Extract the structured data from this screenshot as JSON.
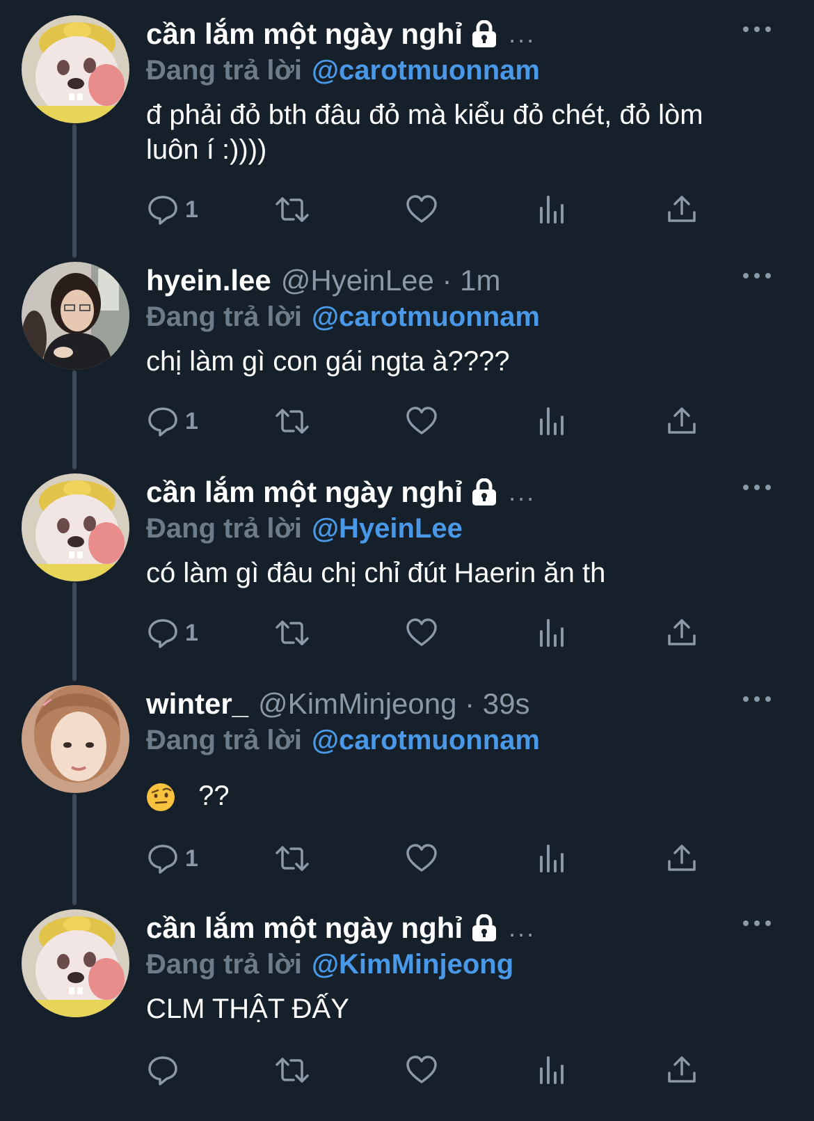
{
  "reply_prefix": "Đang trả lời",
  "more_label": "More options",
  "tweets": [
    {
      "name": "cần lắm một ngày nghỉ",
      "protected": true,
      "meta": "...",
      "reply_to": "@carotmuonnam",
      "text": "đ phải đỏ bth đâu đỏ mà kiểu đỏ chét, đỏ lòm luôn í :))))",
      "reply_count": "1",
      "avatar": "cartoon-bunny-avatar"
    },
    {
      "name": "hyein.lee",
      "handle_meta": "@HyeinLee · 1m",
      "reply_to": "@carotmuonnam",
      "text": "chị làm gì con gái ngta à????",
      "reply_count": "1",
      "avatar": "photo-avatar-girl"
    },
    {
      "name": "cần lắm một ngày nghỉ",
      "protected": true,
      "meta": "...",
      "reply_to": "@HyeinLee",
      "text": "có làm gì đâu chị chỉ đút Haerin ăn th",
      "reply_count": "1",
      "avatar": "cartoon-bunny-avatar"
    },
    {
      "name": "winter_",
      "handle_meta": "@KimMinjeong · 39s",
      "reply_to": "@carotmuonnam",
      "text": "??",
      "emoji": "face-with-raised-eyebrow",
      "reply_count": "1",
      "avatar": "photo-avatar-bow"
    },
    {
      "name": "cần lắm một ngày nghỉ",
      "protected": true,
      "meta": "...",
      "reply_to": "@KimMinjeong",
      "text": "CLM THẬT ĐẤY",
      "reply_count": "",
      "avatar": "cartoon-bunny-avatar"
    }
  ],
  "colors": {
    "background": "#15202b",
    "mention": "#4a99e9",
    "muted": "#8b98a5",
    "thread_line": "#3d4a57"
  }
}
